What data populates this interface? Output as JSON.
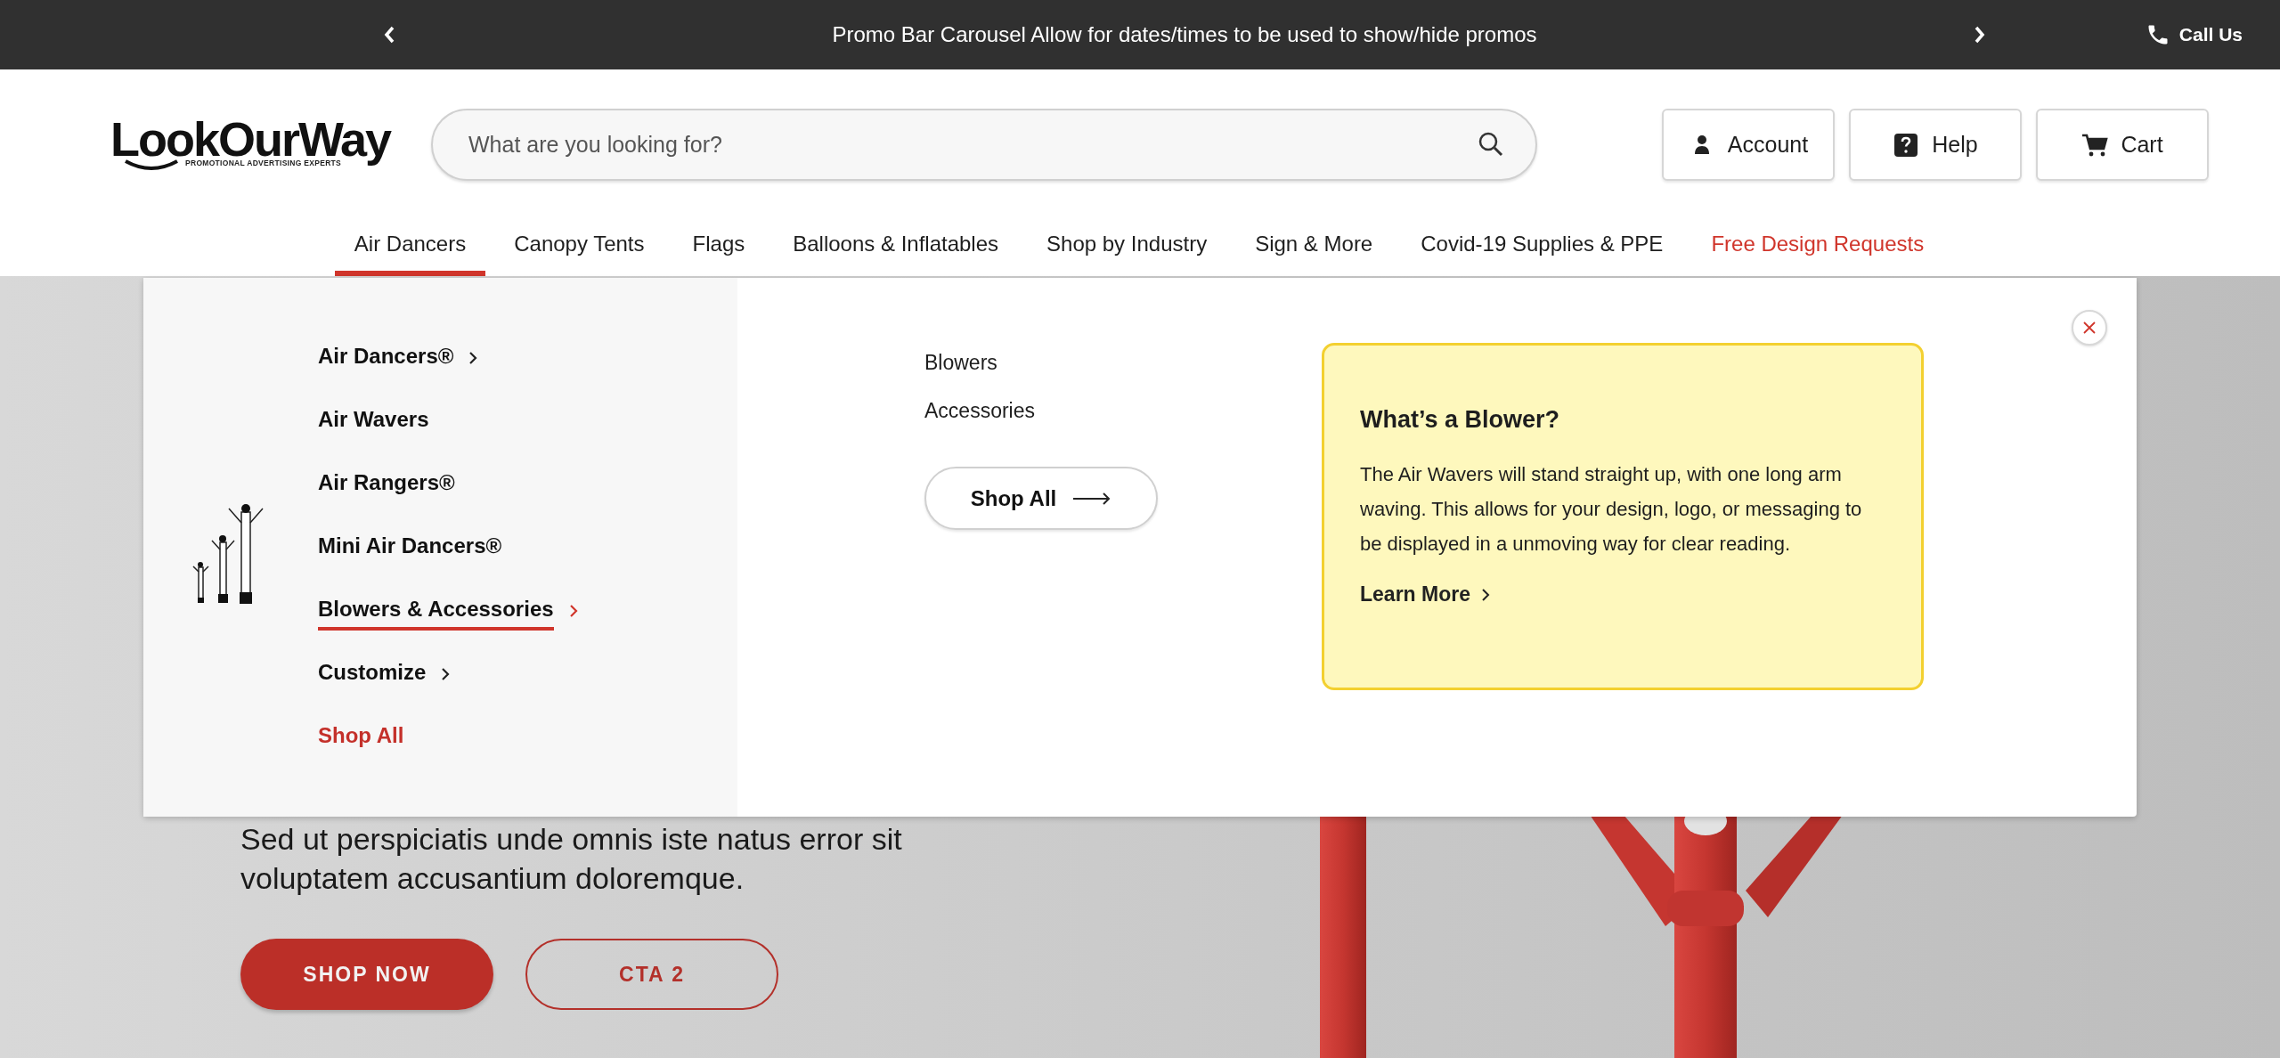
{
  "promo_bar": {
    "message": "Promo Bar Carousel Allow for dates/times to be used to show/hide promos",
    "call_us": "Call Us"
  },
  "header": {
    "logo": {
      "name": "LookOurWay",
      "tagline": "PROMOTIONAL ADVERTISING EXPERTS"
    },
    "search": {
      "placeholder": "What are you looking for?"
    },
    "buttons": [
      {
        "label": "Account",
        "kind": "account"
      },
      {
        "label": "Help",
        "kind": "help"
      },
      {
        "label": "Cart",
        "kind": "cart"
      }
    ]
  },
  "nav": [
    {
      "label": "Air Dancers",
      "selected": true,
      "kind": "link"
    },
    {
      "label": "Canopy Tents",
      "selected": false,
      "kind": "link"
    },
    {
      "label": "Flags",
      "selected": false,
      "kind": "link"
    },
    {
      "label": "Balloons & Inflatables",
      "selected": false,
      "kind": "link"
    },
    {
      "label": "Shop by Industry",
      "selected": false,
      "kind": "link"
    },
    {
      "label": "Sign & More",
      "selected": false,
      "kind": "link"
    },
    {
      "label": "Covid-19 Supplies & PPE",
      "selected": false,
      "kind": "link"
    },
    {
      "label": "Free Design Requests",
      "selected": false,
      "kind": "promo"
    }
  ],
  "mega_menu": {
    "categories": [
      {
        "label": "Air Dancers®",
        "selected": false,
        "has_submenu": true,
        "kind": "link"
      },
      {
        "label": "Air Wavers",
        "selected": false,
        "has_submenu": false,
        "kind": "link"
      },
      {
        "label": "Air Rangers®",
        "selected": false,
        "has_submenu": false,
        "kind": "link"
      },
      {
        "label": "Mini Air Dancers®",
        "selected": false,
        "has_submenu": false,
        "kind": "link"
      },
      {
        "label": "Blowers & Accessories",
        "selected": true,
        "has_submenu": true,
        "kind": "link"
      },
      {
        "label": "Customize",
        "selected": false,
        "has_submenu": true,
        "kind": "link"
      },
      {
        "label": "Shop All",
        "selected": false,
        "has_submenu": false,
        "kind": "shop_all"
      }
    ],
    "subitems": [
      "Blowers",
      "Accessories"
    ],
    "shop_all_button": "Shop All",
    "info_card": {
      "title": "What’s a Blower?",
      "text": "The Air Wavers will stand straight up, with one long arm waving. This allows for your design, logo, or messaging to be displayed in a unmoving way for clear reading.",
      "link": "Learn More"
    }
  },
  "hero": {
    "text": "Sed ut perspiciatis unde omnis iste natus error sit voluptatem accusantium doloremque.",
    "buttons": [
      {
        "label": "SHOP NOW",
        "kind": "primary"
      },
      {
        "label": "CTA 2",
        "kind": "outline"
      }
    ]
  }
}
